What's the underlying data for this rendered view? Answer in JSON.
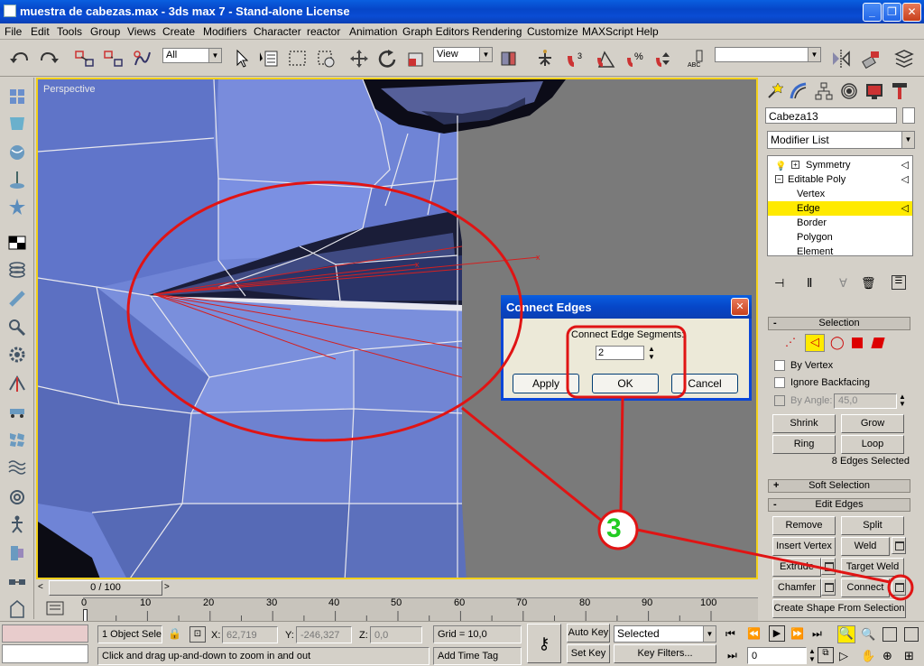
{
  "window": {
    "title": "muestra de cabezas.max - 3ds max 7  - Stand-alone License"
  },
  "menu": [
    "File",
    "Edit",
    "Tools",
    "Group",
    "Views",
    "Create",
    "Modifiers",
    "Character",
    "reactor",
    "Animation",
    "Graph Editors",
    "Rendering",
    "Customize",
    "MAXScript",
    "Help"
  ],
  "toolbar": {
    "selection_filter": "All",
    "ref_coord": "View",
    "named_sel": ""
  },
  "viewport": {
    "label": "Perspective"
  },
  "panel": {
    "object_name": "Cabeza13",
    "modifier_list": "Modifier List",
    "stack": {
      "symmetry": "Symmetry",
      "editable_poly": "Editable Poly",
      "vertex": "Vertex",
      "edge": "Edge",
      "border": "Border",
      "polygon": "Polygon",
      "element": "Element"
    },
    "selection": {
      "title": "Selection",
      "by_vertex": "By Vertex",
      "ignore_backfacing": "Ignore Backfacing",
      "by_angle": "By Angle:",
      "angle_value": "45,0",
      "shrink": "Shrink",
      "grow": "Grow",
      "ring": "Ring",
      "loop": "Loop",
      "status": "8 Edges Selected"
    },
    "soft_selection": "Soft Selection",
    "edit_edges": {
      "title": "Edit Edges",
      "remove": "Remove",
      "split": "Split",
      "insert_vertex": "Insert Vertex",
      "weld": "Weld",
      "extrude": "Extrude",
      "target_weld": "Target Weld",
      "chamfer": "Chamfer",
      "connect": "Connect",
      "create_shape": "Create Shape From Selection"
    }
  },
  "dialog": {
    "title": "Connect Edges",
    "segments_label": "Connect Edge Segments:",
    "segments_value": "2",
    "apply": "Apply",
    "ok": "OK",
    "cancel": "Cancel"
  },
  "annotation": {
    "step": "3"
  },
  "timeline": {
    "slider": "0 / 100",
    "ticks": [
      "0",
      "10",
      "20",
      "30",
      "40",
      "50",
      "60",
      "70",
      "80",
      "90",
      "100"
    ]
  },
  "status": {
    "selected_count": "1 Object Sele",
    "x_label": "X:",
    "x_value": "62,719",
    "y_label": "Y:",
    "y_value": "-246,327",
    "z_label": "Z:",
    "z_value": "0,0",
    "grid": "Grid = 10,0",
    "prompt": "Click and drag up-and-down to zoom in and out",
    "add_time_tag": "Add Time Tag",
    "auto_key": "Auto Key",
    "set_key": "Set Key",
    "key_mode": "Selected",
    "key_filters": "Key Filters...",
    "frame": "0"
  }
}
